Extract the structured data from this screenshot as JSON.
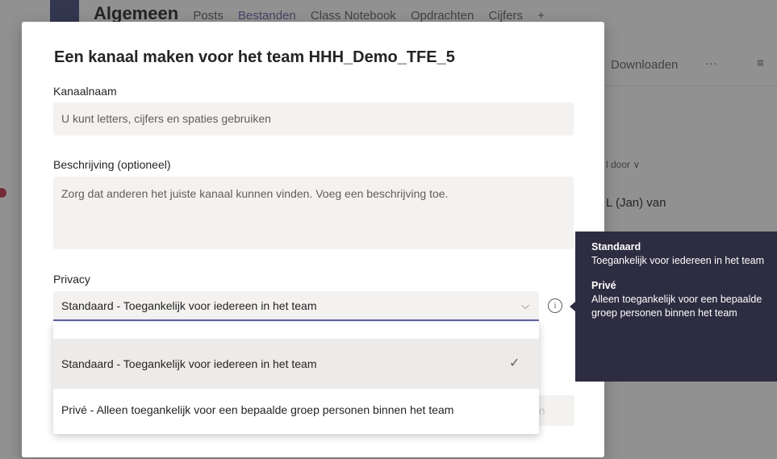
{
  "background": {
    "team_name": "Algemeen",
    "tabs": [
      "Posts",
      "Bestanden",
      "Class Notebook",
      "Opdrachten",
      "Cijfers"
    ],
    "add_tab": "+",
    "download_label": "Downloaden",
    "more": "···",
    "sort_label": "l door ∨",
    "modified_by": "L (Jan) van",
    "disabled_button_fragment": "en"
  },
  "dialog": {
    "title": "Een kanaal maken voor het team HHH_Demo_TFE_5",
    "channel_name_label": "Kanaalnaam",
    "channel_name_placeholder": "U kunt letters, cijfers en spaties gebruiken",
    "description_label": "Beschrijving (optioneel)",
    "description_placeholder": "Zorg dat anderen het juiste kanaal kunnen vinden. Voeg een beschrijving toe.",
    "privacy_label": "Privacy",
    "privacy_selected": "Standaard - Toegankelijk voor iedereen in het team",
    "info_icon": "i"
  },
  "dropdown": {
    "options": [
      {
        "label": "Standaard - Toegankelijk voor iedereen in het team",
        "selected": true
      },
      {
        "label": "Privé - Alleen toegankelijk voor een bepaalde groep personen binnen het team",
        "selected": false
      }
    ],
    "check": "✓"
  },
  "tooltip": {
    "standard_title": "Standaard",
    "standard_text": "Toegankelijk voor iedereen in het team",
    "private_title": "Privé",
    "private_text": "Alleen toegankelijk voor een bepaalde groep personen binnen het team"
  },
  "colors": {
    "accent": "#6264a7",
    "tooltip_bg": "#2d2c41"
  }
}
